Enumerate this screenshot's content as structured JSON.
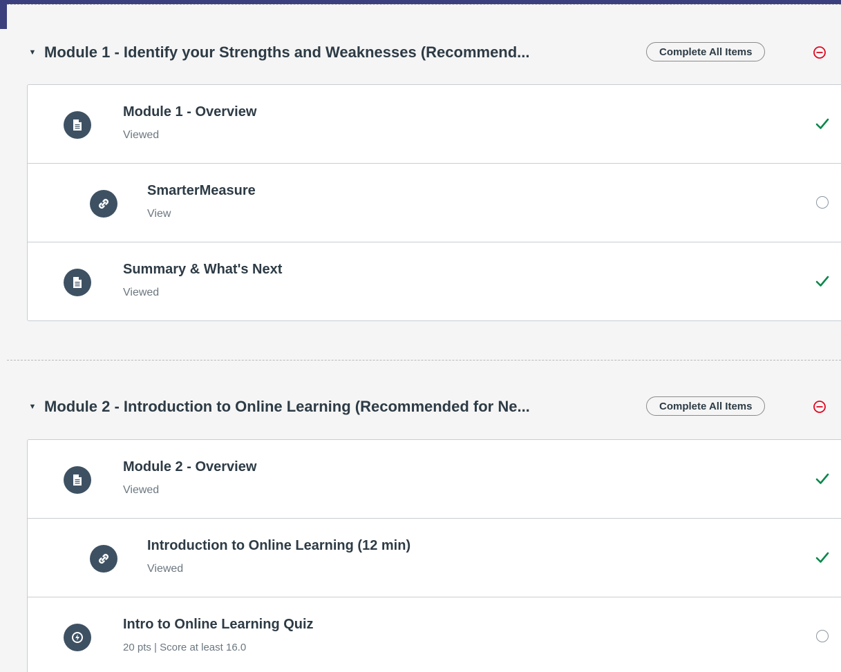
{
  "colors": {
    "accent_banner": "#3c3f7e",
    "icon_bg": "#3e5163",
    "check": "#0b874b",
    "danger": "#e0061f",
    "text": "#2d3b45",
    "subtext": "#6b7780"
  },
  "modules": [
    {
      "title": "Module 1 - Identify your Strengths and Weaknesses (Recommend...",
      "complete_label": "Complete All Items",
      "items": [
        {
          "title": "Module 1 - Overview",
          "sub": "Viewed",
          "icon": "page-icon",
          "indent": false,
          "status": "complete"
        },
        {
          "title": "SmarterMeasure",
          "sub": "View",
          "icon": "external-link-icon",
          "indent": true,
          "status": "incomplete"
        },
        {
          "title": "Summary & What's Next",
          "sub": "Viewed",
          "icon": "page-icon",
          "indent": false,
          "status": "complete"
        }
      ]
    },
    {
      "title": "Module 2 - Introduction to Online Learning (Recommended for Ne...",
      "complete_label": "Complete All Items",
      "items": [
        {
          "title": "Module 2 - Overview",
          "sub": "Viewed",
          "icon": "page-icon",
          "indent": false,
          "status": "complete"
        },
        {
          "title": "Introduction to Online Learning (12 min)",
          "sub": "Viewed",
          "icon": "external-link-icon",
          "indent": true,
          "status": "complete"
        },
        {
          "title": "Intro to Online Learning Quiz",
          "sub": "20 pts  |  Score at least 16.0",
          "icon": "quiz-icon",
          "indent": false,
          "status": "incomplete"
        }
      ]
    }
  ]
}
